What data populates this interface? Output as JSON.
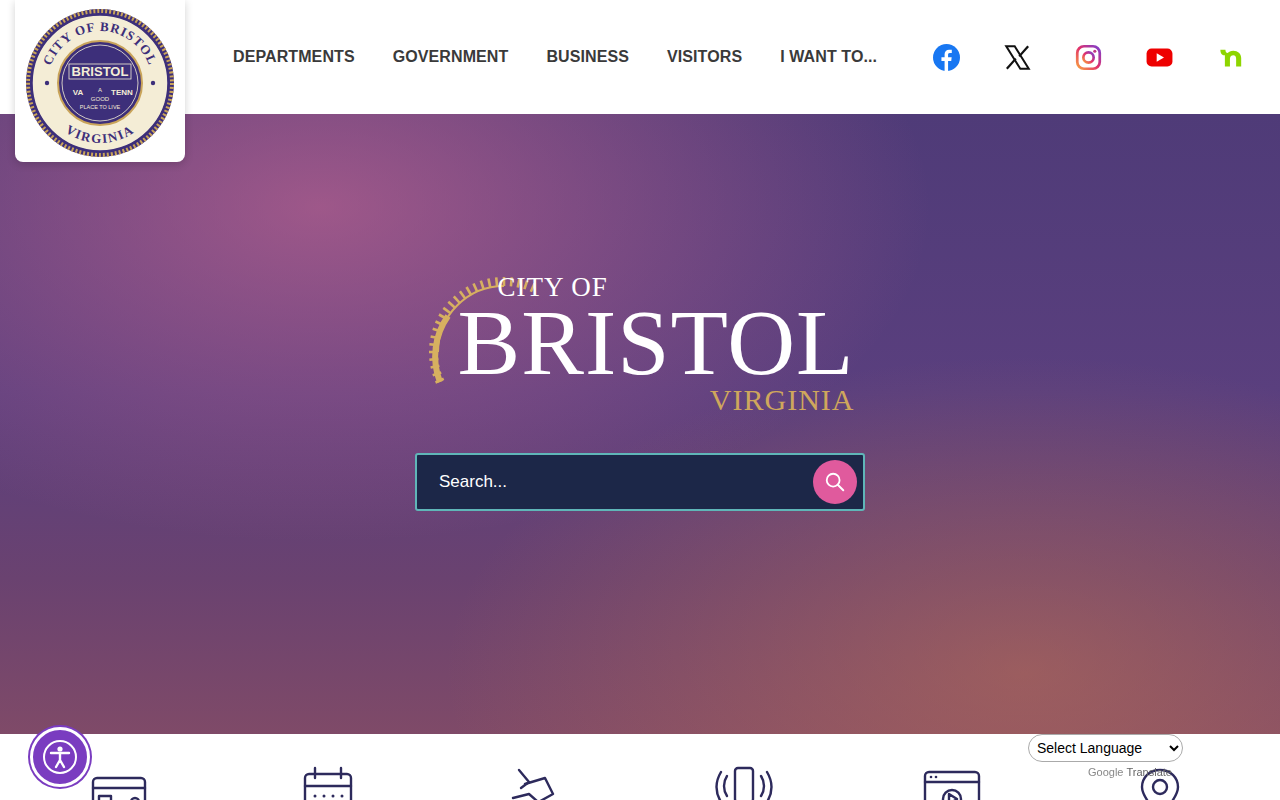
{
  "header": {
    "seal": {
      "ring_top": "CITY OF BRISTOL",
      "center": "BRISTOL",
      "left": "VA",
      "right": "TENN",
      "motto_top": "A",
      "motto_mid": "GOOD",
      "motto_bottom": "PLACE TO LIVE",
      "ring_bottom": "VIRGINIA"
    },
    "nav": [
      {
        "label": "DEPARTMENTS"
      },
      {
        "label": "GOVERNMENT"
      },
      {
        "label": "BUSINESS"
      },
      {
        "label": "VISITORS"
      },
      {
        "label": "I WANT TO..."
      }
    ]
  },
  "hero": {
    "wordmark": {
      "top": "CITY OF",
      "main": "BRISTOL",
      "bottom": "VIRGINIA"
    },
    "search": {
      "placeholder": "Search..."
    }
  },
  "translate": {
    "select": "Select Language",
    "brand": "Google",
    "label": "Translate"
  }
}
